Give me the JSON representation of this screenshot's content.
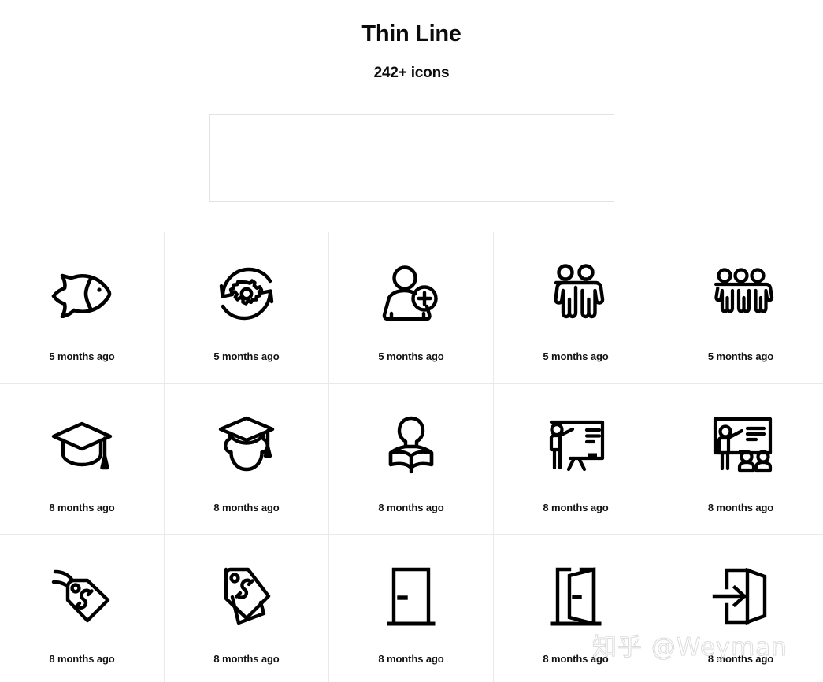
{
  "header": {
    "title": "Thin Line",
    "subtitle": "242+ icons"
  },
  "promo_slot": {
    "content": ""
  },
  "colors": {
    "background": "#ffffff",
    "text": "#0b0b0b",
    "grid_line": "#e9e9e9",
    "panel_border": "#e3e3e3",
    "icon_stroke": "#000000",
    "watermark": "#dcdcdc"
  },
  "grid": {
    "columns": 5,
    "rows": [
      {
        "cells": [
          {
            "icon": "fish-icon",
            "label": "5 months ago"
          },
          {
            "icon": "settings-sync-icon",
            "label": "5 months ago"
          },
          {
            "icon": "add-user-icon",
            "label": "5 months ago"
          },
          {
            "icon": "two-people-icon",
            "label": "5 months ago"
          },
          {
            "icon": "three-people-group-icon",
            "label": "5 months ago"
          }
        ]
      },
      {
        "cells": [
          {
            "icon": "graduation-cap-icon",
            "label": "8 months ago"
          },
          {
            "icon": "graduate-person-icon",
            "label": "8 months ago"
          },
          {
            "icon": "person-reading-book-icon",
            "label": "8 months ago"
          },
          {
            "icon": "presenter-easel-icon",
            "label": "8 months ago"
          },
          {
            "icon": "teacher-classroom-icon",
            "label": "8 months ago"
          }
        ]
      },
      {
        "cells": [
          {
            "icon": "price-tag-string-icon",
            "label": "8 months ago"
          },
          {
            "icon": "double-price-tag-icon",
            "label": "8 months ago"
          },
          {
            "icon": "closed-door-icon",
            "label": "8 months ago"
          },
          {
            "icon": "open-door-icon",
            "label": "8 months ago"
          },
          {
            "icon": "door-enter-icon",
            "label": "8 months ago"
          }
        ]
      }
    ]
  },
  "watermark": {
    "text": "知乎 @Weyman"
  }
}
